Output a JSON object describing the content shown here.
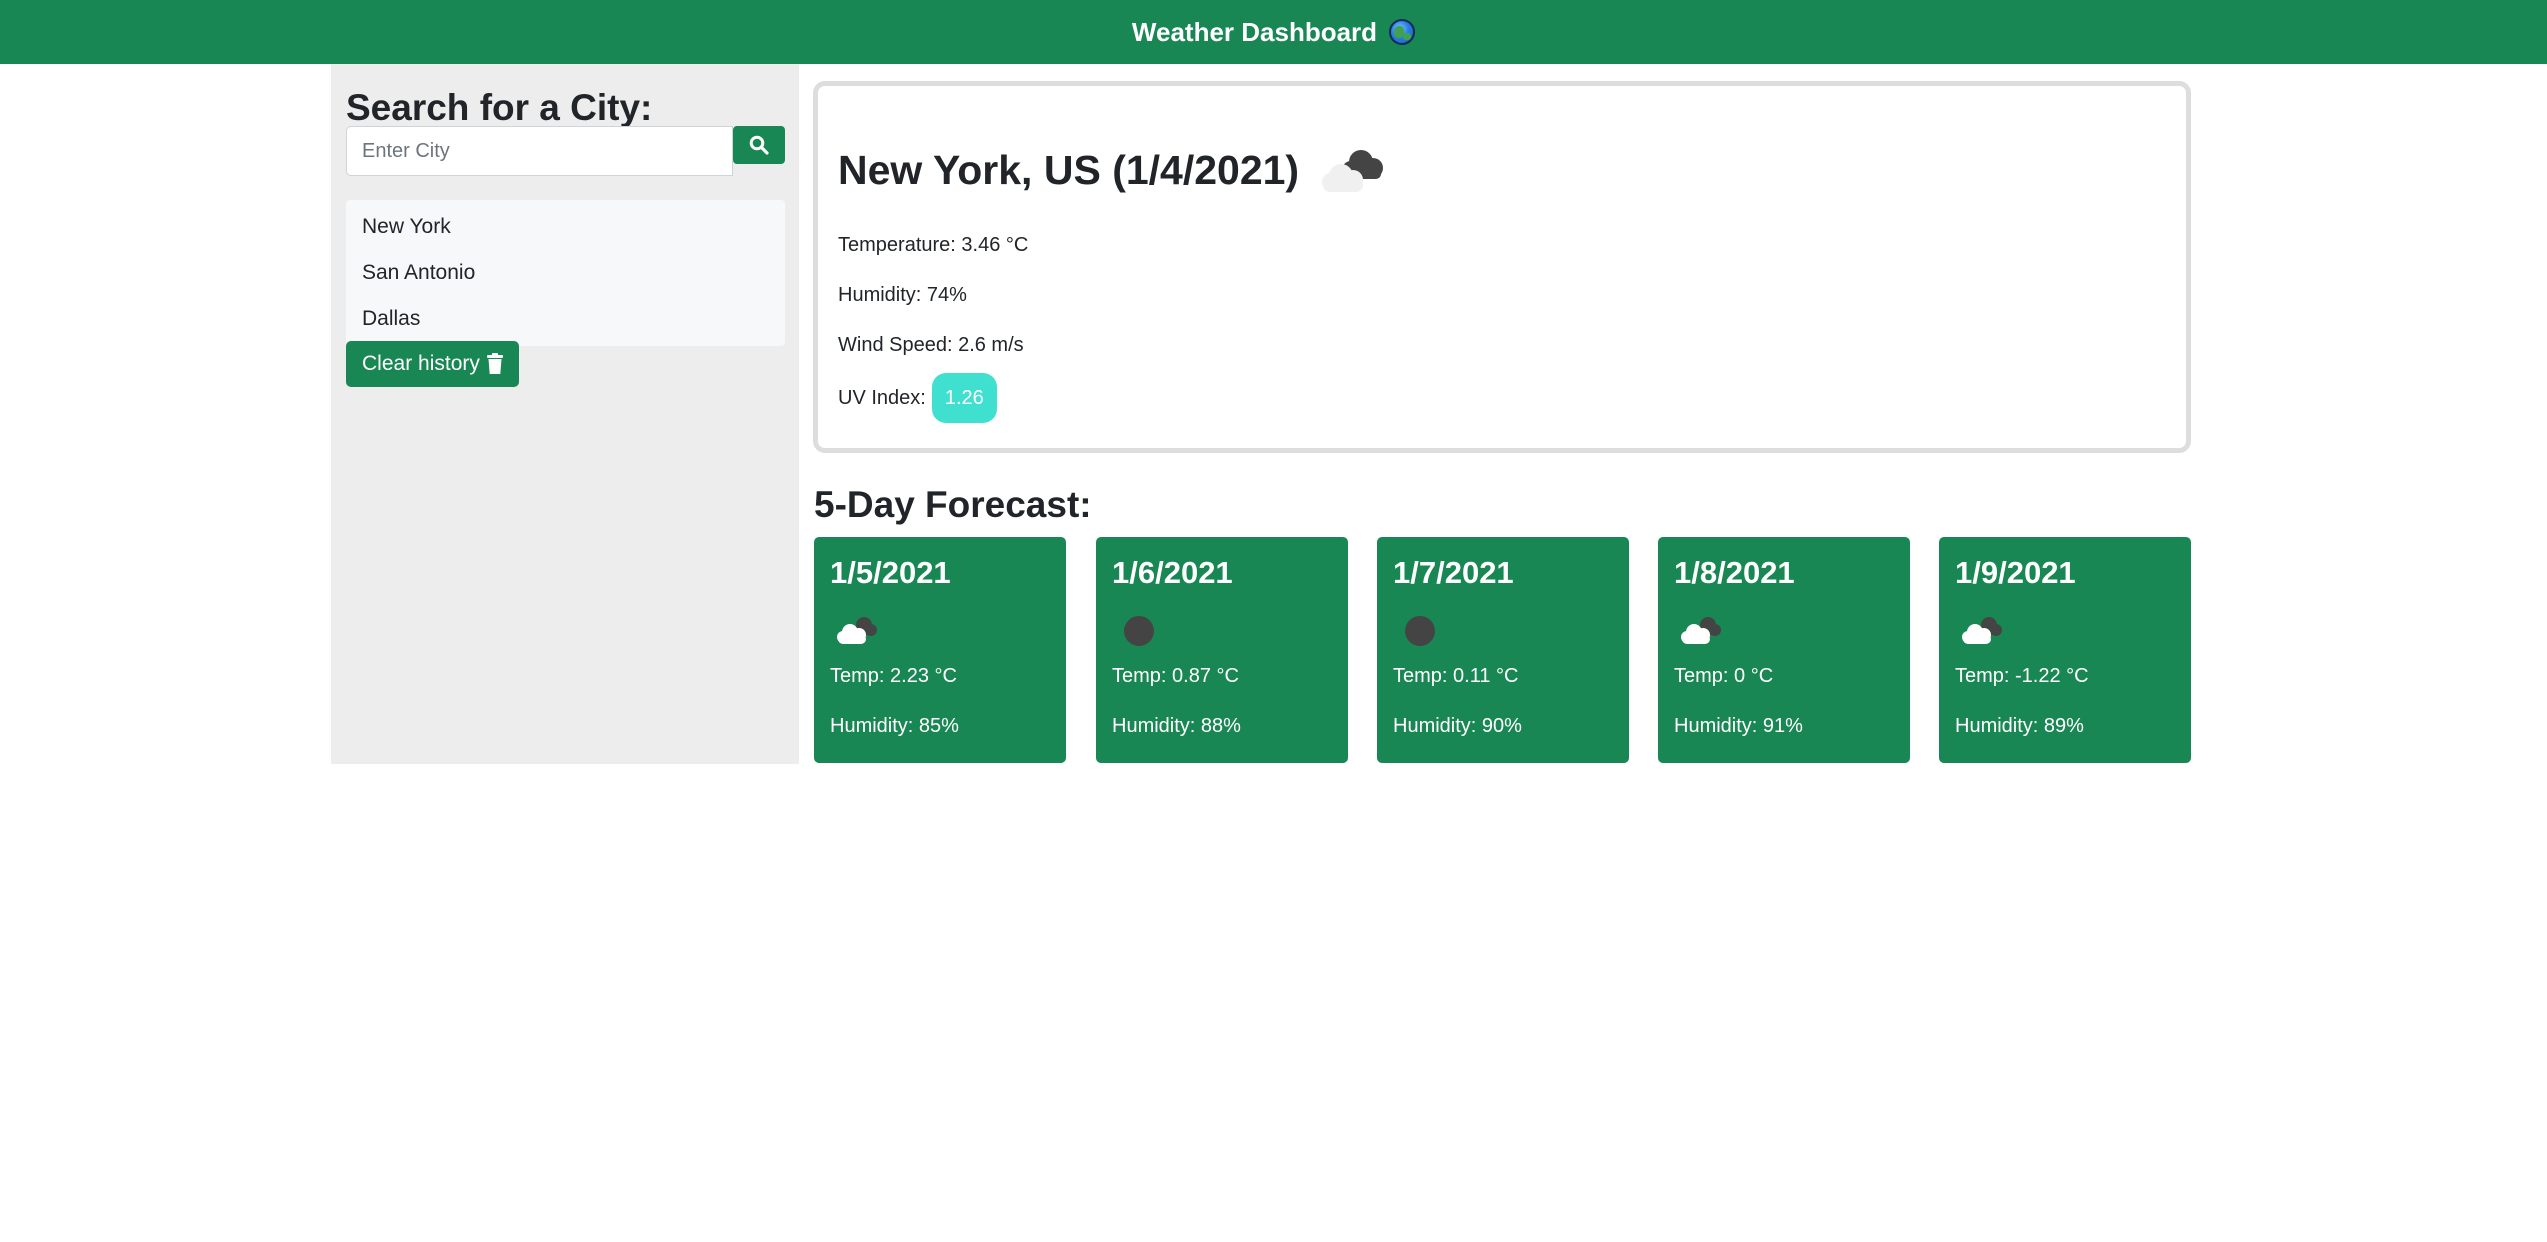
{
  "header": {
    "title": "Weather Dashboard",
    "icon": "globe-icon"
  },
  "sidebar": {
    "heading": "Search for a City:",
    "search": {
      "placeholder": "Enter City",
      "value": "",
      "button_icon": "search-icon"
    },
    "history": [
      {
        "label": "New York"
      },
      {
        "label": "San Antonio"
      },
      {
        "label": "Dallas"
      }
    ],
    "clear_label": "Clear history",
    "clear_icon": "trash-icon"
  },
  "current": {
    "title": "New York, US (1/4/2021)",
    "icon": "cloud-icon",
    "temperature": "Temperature: 3.46 °C",
    "humidity": "Humidity: 74%",
    "wind": "Wind Speed: 2.6 m/s",
    "uv_label": "UV Index:",
    "uv_value": "1.26"
  },
  "forecast": {
    "heading": "5-Day Forecast:",
    "days": [
      {
        "date": "1/5/2021",
        "icon": "cloud-icon",
        "temp": "Temp: 2.23 °C",
        "humidity": "Humidity: 85%"
      },
      {
        "date": "1/6/2021",
        "icon": "dark-circle-icon",
        "temp": "Temp: 0.87 °C",
        "humidity": "Humidity: 88%"
      },
      {
        "date": "1/7/2021",
        "icon": "dark-circle-icon",
        "temp": "Temp: 0.11 °C",
        "humidity": "Humidity: 90%"
      },
      {
        "date": "1/8/2021",
        "icon": "cloud-icon",
        "temp": "Temp: 0 °C",
        "humidity": "Humidity: 91%"
      },
      {
        "date": "1/9/2021",
        "icon": "cloud-icon",
        "temp": "Temp: -1.22 °C",
        "humidity": "Humidity: 89%"
      }
    ]
  },
  "colors": {
    "primary": "#198754",
    "sidebar_bg": "#ededed",
    "uv_badge": "#40e0d0"
  }
}
